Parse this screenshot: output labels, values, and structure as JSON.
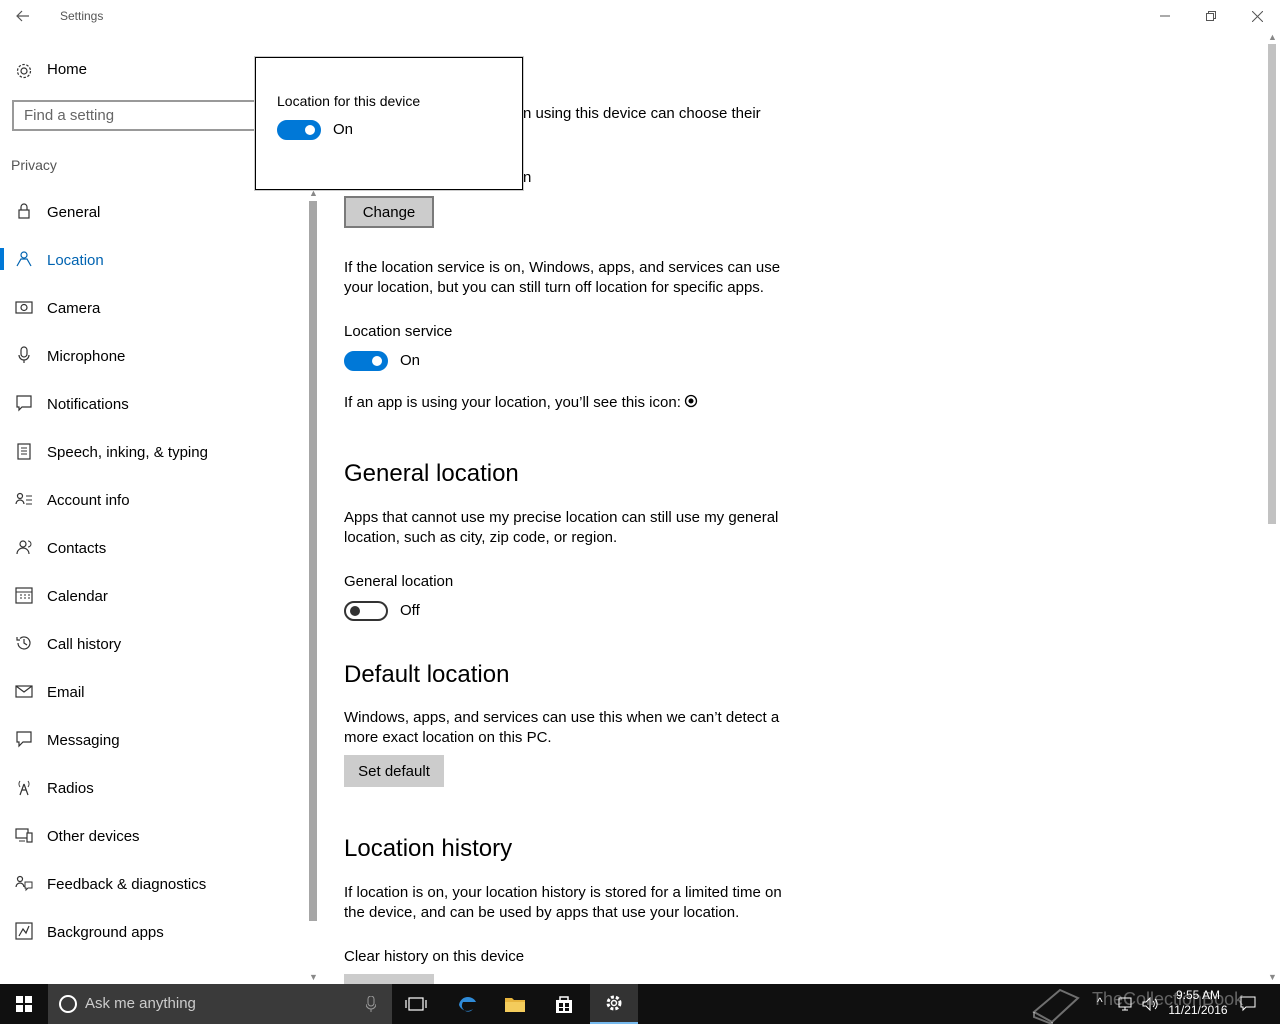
{
  "window": {
    "title": "Settings"
  },
  "sidebar": {
    "home_label": "Home",
    "search_placeholder": "Find a setting",
    "section_label": "Privacy",
    "items": [
      {
        "label": "General",
        "icon": "lock-icon",
        "active": false
      },
      {
        "label": "Location",
        "icon": "location-person-icon",
        "active": true
      },
      {
        "label": "Camera",
        "icon": "camera-icon",
        "active": false
      },
      {
        "label": "Microphone",
        "icon": "microphone-icon",
        "active": false
      },
      {
        "label": "Notifications",
        "icon": "notification-icon",
        "active": false
      },
      {
        "label": "Speech, inking, & typing",
        "icon": "clipboard-icon",
        "active": false
      },
      {
        "label": "Account info",
        "icon": "account-info-icon",
        "active": false
      },
      {
        "label": "Contacts",
        "icon": "contacts-icon",
        "active": false
      },
      {
        "label": "Calendar",
        "icon": "calendar-icon",
        "active": false
      },
      {
        "label": "Call history",
        "icon": "history-icon",
        "active": false
      },
      {
        "label": "Email",
        "icon": "email-icon",
        "active": false
      },
      {
        "label": "Messaging",
        "icon": "message-icon",
        "active": false
      },
      {
        "label": "Radios",
        "icon": "radio-tower-icon",
        "active": false
      },
      {
        "label": "Other devices",
        "icon": "devices-icon",
        "active": false
      },
      {
        "label": "Feedback & diagnostics",
        "icon": "feedback-icon",
        "active": false
      },
      {
        "label": "Background apps",
        "icon": "background-apps-icon",
        "active": false
      }
    ]
  },
  "popup": {
    "title": "Location for this device",
    "toggle_state": "On"
  },
  "main": {
    "partial_line1": "n using this device can choose their",
    "partial_line2": "n",
    "change_button": "Change",
    "service_desc_line1": "If the location service is on, Windows, apps, and services can use",
    "service_desc_line2": "your location, but you can still turn off location for specific apps.",
    "service_label": "Location service",
    "service_state": "On",
    "icon_note": "If an app is using your location, you’ll see this icon:",
    "general": {
      "heading": "General location",
      "desc_line1": "Apps that cannot use my precise location can still use my general",
      "desc_line2": "location, such as city, zip code, or region.",
      "toggle_label": "General location",
      "toggle_state": "Off"
    },
    "default": {
      "heading": "Default location",
      "desc_line1": "Windows, apps, and services can use this when we can’t detect a",
      "desc_line2": "more exact location on this PC.",
      "button": "Set default"
    },
    "history": {
      "heading": "Location history",
      "desc_line1": "If location is on, your location history is stored for a limited time on",
      "desc_line2": "the device, and can be used by apps that use your location.",
      "clear_label": "Clear history on this device"
    }
  },
  "taskbar": {
    "search_placeholder": "Ask me anything",
    "time": "9:55 AM",
    "date": "11/21/2016",
    "watermark": "TheCollectionBook"
  },
  "colors": {
    "accent": "#0078d7",
    "taskbar": "#101010"
  }
}
